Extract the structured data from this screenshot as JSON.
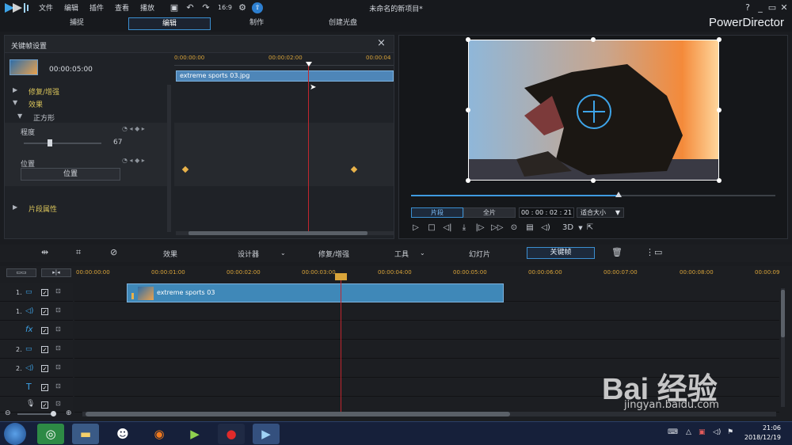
{
  "menu": [
    "文件",
    "编辑",
    "插件",
    "查看",
    "播放"
  ],
  "window_title": "未命名的新项目*",
  "brand": "PowerDirector",
  "tabs": [
    "捕捉",
    "编辑",
    "制作",
    "创建光盘"
  ],
  "active_tab": "编辑",
  "window_controls": [
    "?",
    "_",
    "▭",
    "✕"
  ],
  "keyframe_panel": {
    "title": "关键帧设置",
    "clip_time": "00:00:05:00",
    "ruler": [
      "0:00:00:00",
      "00:00:02:00",
      "00:00:04"
    ],
    "clip_name": "extreme sports 03.jpg",
    "sections": {
      "repair": "修复/增强",
      "effects": "效果",
      "effect_name": "正方形",
      "degree_label": "程度",
      "degree_value": "67",
      "degree_fraction": 0.67,
      "position_label": "位置",
      "position_button": "位置",
      "clip_props": "片段属性"
    }
  },
  "preview": {
    "mode_clip": "片段",
    "mode_full": "全片",
    "timecode": "00 : 00 : 02 : 21",
    "fit": "适合大小",
    "view3d": "3D",
    "progress": 0.57
  },
  "toolbar": {
    "effects": "效果",
    "designer": "设计器",
    "repair": "修复/增强",
    "tools": "工具",
    "slideshow": "幻灯片",
    "keyframe": "关键帧"
  },
  "timeline": {
    "ruler": [
      "00:00:00:00",
      "00:00:01:00",
      "00:00:02:00",
      "00:00:03:00",
      "00:00:04:00",
      "00:00:05:00",
      "00:00:06:00",
      "00:00:07:00",
      "00:00:08:00",
      "00:00:09"
    ],
    "clip_name": "extreme sports 03",
    "tracks": [
      {
        "num": "1.",
        "icon": "video-track-icon"
      },
      {
        "num": "1.",
        "icon": "audio-track-icon"
      },
      {
        "num": "",
        "icon": "fx-track-icon"
      },
      {
        "num": "2.",
        "icon": "video-track-icon"
      },
      {
        "num": "2.",
        "icon": "audio-track-icon"
      },
      {
        "num": "",
        "icon": "title-track-icon"
      },
      {
        "num": "",
        "icon": "voice-track-icon"
      }
    ]
  },
  "taskbar": {
    "time": "21:06",
    "date": "2018/12/19"
  },
  "watermark": {
    "text": "Bai 经验",
    "url": "jingyan.baidu.com"
  }
}
